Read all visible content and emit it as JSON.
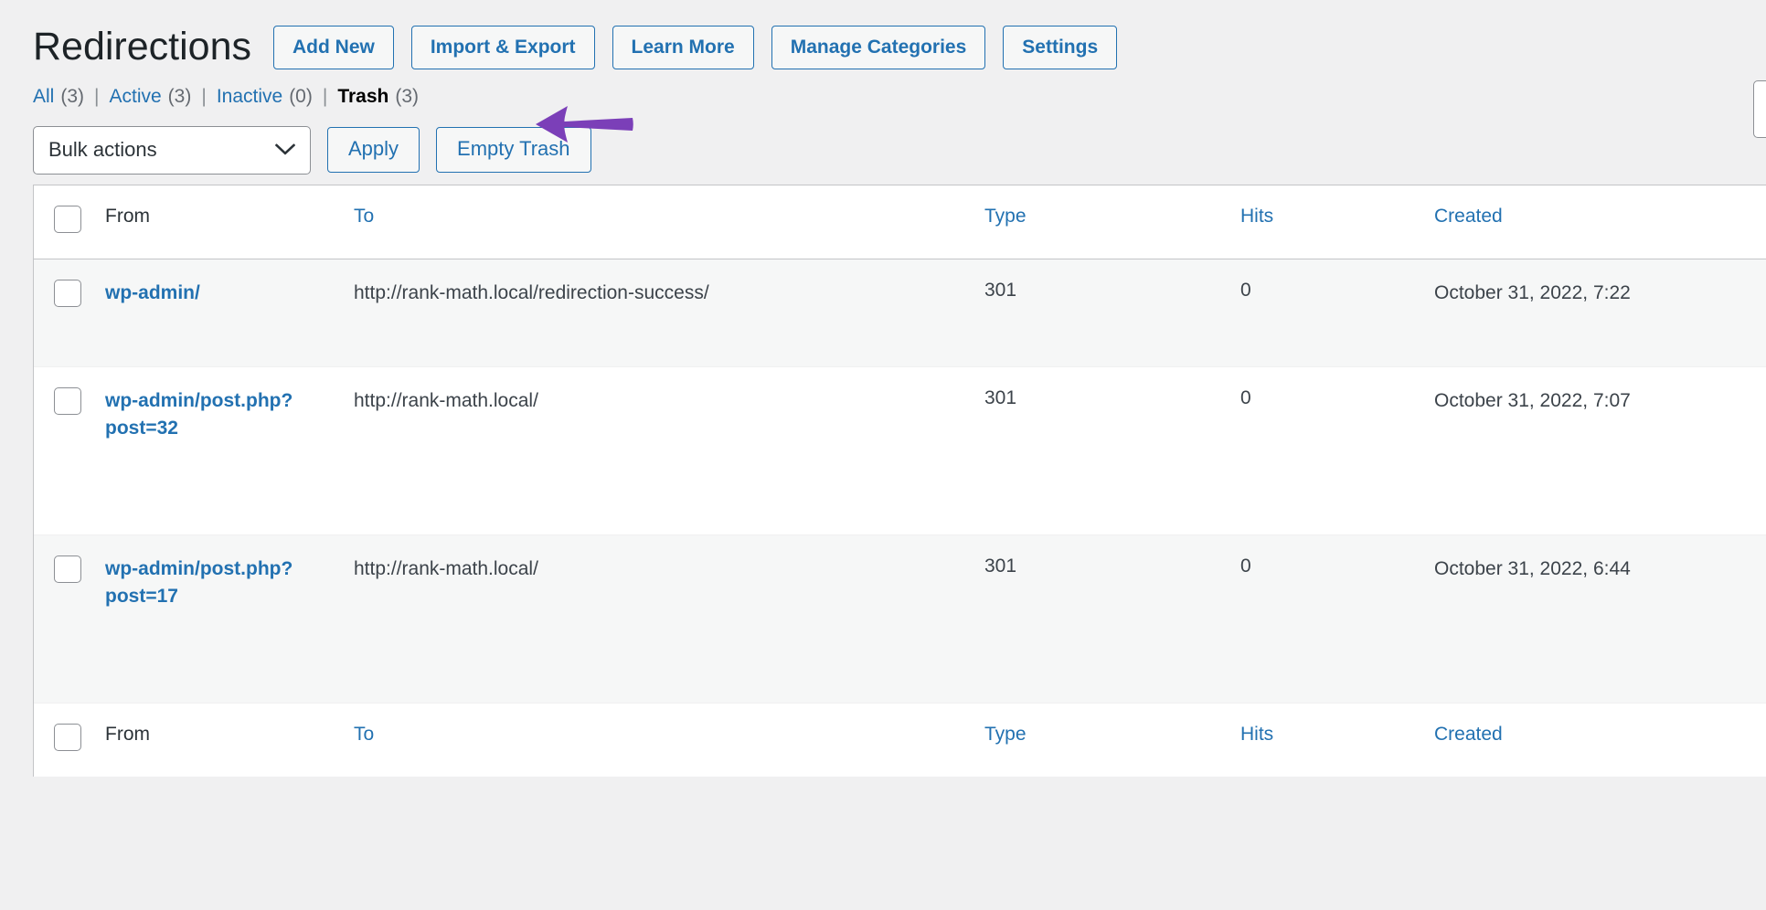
{
  "header": {
    "title": "Redirections",
    "buttons": [
      {
        "label": "Add New",
        "name": "add-new-button"
      },
      {
        "label": "Import & Export",
        "name": "import-export-button"
      },
      {
        "label": "Learn More",
        "name": "learn-more-button"
      },
      {
        "label": "Manage Categories",
        "name": "manage-categories-button"
      },
      {
        "label": "Settings",
        "name": "settings-button"
      }
    ]
  },
  "filters": {
    "items": [
      {
        "label": "All",
        "count": "(3)",
        "current": false
      },
      {
        "label": "Active",
        "count": "(3)",
        "current": false
      },
      {
        "label": "Inactive",
        "count": "(0)",
        "current": false
      },
      {
        "label": "Trash",
        "count": "(3)",
        "current": true
      }
    ],
    "separator": "|"
  },
  "tablenav": {
    "bulk_actions_value": "Bulk actions",
    "apply_label": "Apply",
    "empty_trash_label": "Empty Trash"
  },
  "table": {
    "columns": {
      "from": "From",
      "to": "To",
      "type": "Type",
      "hits": "Hits",
      "created": "Created"
    },
    "rows": [
      {
        "from": "wp-admin/",
        "to": "http://rank-math.local/redirection-success/",
        "type": "301",
        "hits": "0",
        "created": "October 31, 2022, 7:22"
      },
      {
        "from": "wp-admin/post.php?post=32",
        "to": "http://rank-math.local/",
        "type": "301",
        "hits": "0",
        "created": "October 31, 2022, 7:07"
      },
      {
        "from": "wp-admin/post.php?post=17",
        "to": "http://rank-math.local/",
        "type": "301",
        "hits": "0",
        "created": "October 31, 2022, 6:44"
      }
    ]
  },
  "annotation": {
    "arrow_color": "#7b3fb8",
    "arrow_direction": "left"
  },
  "colors": {
    "link": "#2271b1",
    "page_background": "#f0f0f1",
    "row_alt_background": "#f6f7f7",
    "text": "#3c434a"
  }
}
